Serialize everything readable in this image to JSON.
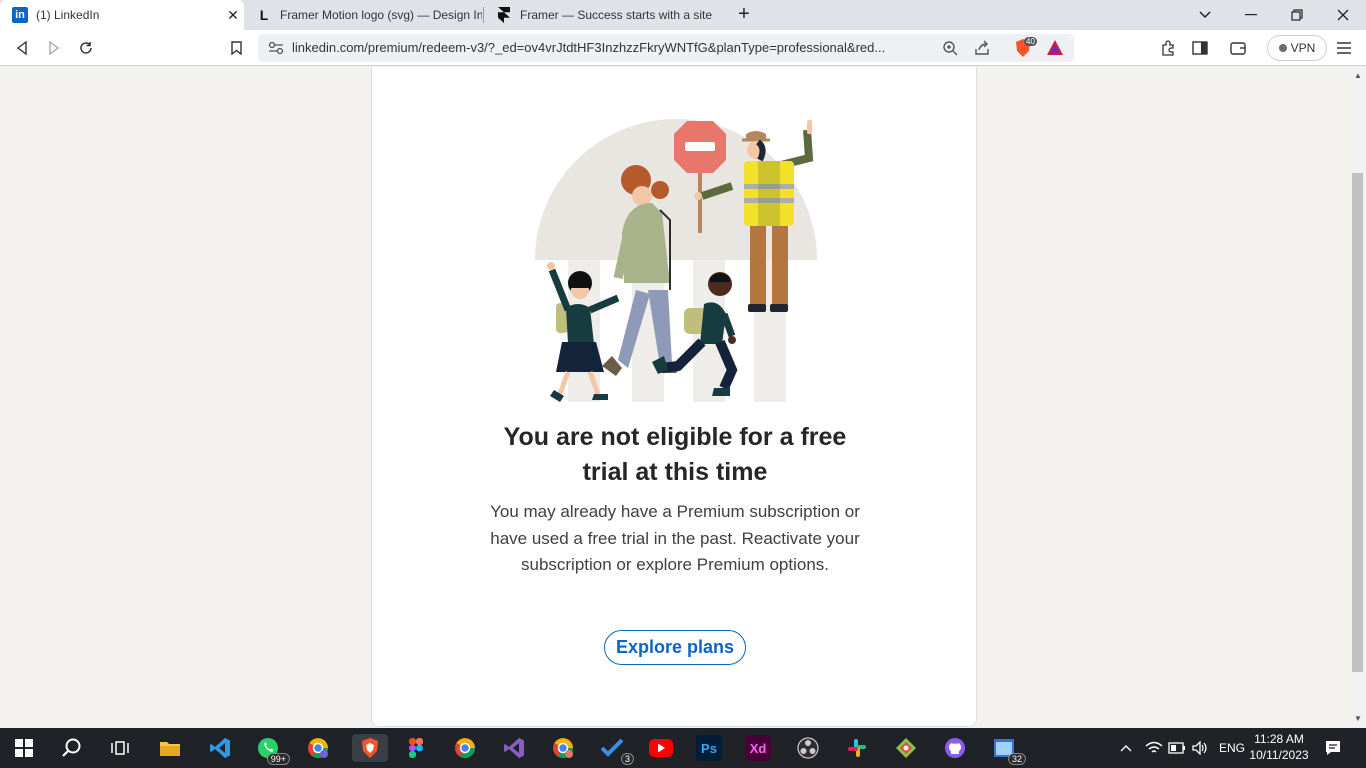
{
  "browser": {
    "tabs": [
      {
        "title": "(1) LinkedIn",
        "favicon": "in"
      },
      {
        "title": "Framer Motion logo (svg) — Design In",
        "favicon": "L"
      },
      {
        "title": "Framer — Success starts with a site",
        "favicon": "framer"
      }
    ],
    "url": "linkedin.com/premium/redeem-v3/?_ed=ov4vrJtdtHF3InzhzzFkryWNTfG&planType=professional&red...",
    "brave_shield_count": "40",
    "vpn_label": "VPN"
  },
  "page": {
    "heading_line1": "You are not eligible for a free",
    "heading_line2": "trial at this time",
    "description": "You may already have a Premium subscription or have used a free trial in the past. Reactivate your subscription or explore Premium options.",
    "explore_button": "Explore plans"
  },
  "taskbar": {
    "whatsapp_badge": "99+",
    "todo_badge": "3",
    "explorer_badge": "32",
    "photoshop_label": "Ps",
    "xd_label": "Xd",
    "language": "ENG",
    "time": "11:28 AM",
    "date": "10/11/2023"
  },
  "colors": {
    "linkedin_blue": "#0a66c2",
    "page_bg": "#f4f2ee",
    "taskbar_bg": "#1f2227"
  }
}
